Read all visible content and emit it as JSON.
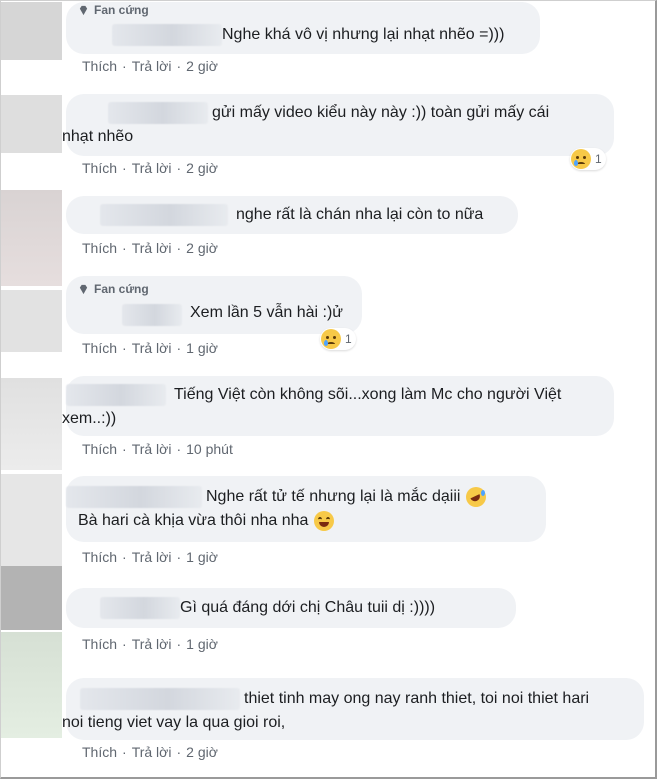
{
  "badge_label": "Fan cứng",
  "action_like": "Thích",
  "action_reply": "Trả lời",
  "separator": "·",
  "comments": [
    {
      "lines": [
        "Nghe khá vô vị nhưng lại nhạt nhẽo =)))"
      ],
      "time": "2 giờ",
      "badge": true
    },
    {
      "lines": [
        "gửi mấy video kiểu này này :)) toàn gửi mấy cái",
        "nhạt nhẽo"
      ],
      "time": "2 giờ",
      "reaction": {
        "icon": "sad-face-icon",
        "count": "1"
      }
    },
    {
      "lines": [
        "nghe rất là chán nha lại còn to nữa"
      ],
      "time": "2 giờ"
    },
    {
      "lines": [
        "Xem lần 5 vẫn hài :)ử"
      ],
      "time": "1 giờ",
      "badge": true,
      "reaction": {
        "icon": "sad-face-icon",
        "count": "1"
      }
    },
    {
      "lines": [
        "Tiếng Việt còn không sõi...xong làm Mc cho người Việt",
        "xem..:))"
      ],
      "time": "10 phút"
    },
    {
      "lines": [
        "Nghe rất tử tế nhưng lại là mắc dạiii",
        "Bà hari cà khịa vừa thôi nha nha"
      ],
      "time": "1 giờ",
      "inline_icons": [
        "rofl-face-icon",
        "grinning-face-icon"
      ]
    },
    {
      "lines": [
        "Gì quá đáng dới chị Châu tuii dị :))))"
      ],
      "time": "1 giờ"
    },
    {
      "lines": [
        "thiet tinh may ong nay ranh thiet, toi noi thiet hari",
        "noi tieng viet vay la qua gioi roi,"
      ],
      "time": "2 giờ"
    }
  ],
  "colors": {
    "bubble": "#f0f2f5",
    "meta": "#606770",
    "text": "#1c1e21"
  }
}
